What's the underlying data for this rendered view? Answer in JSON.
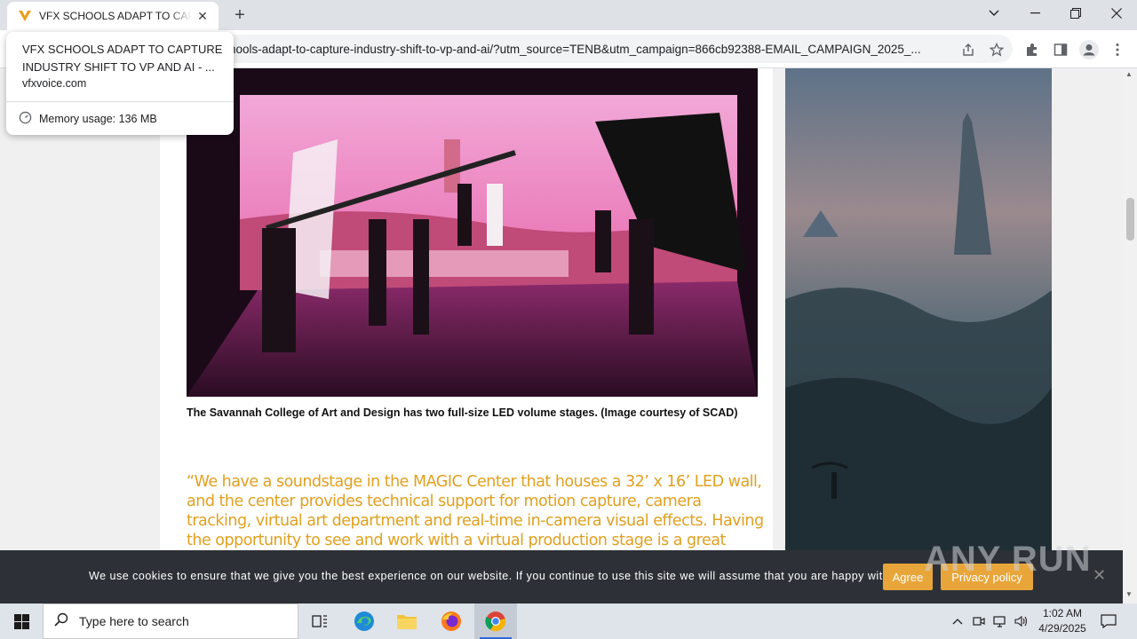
{
  "browser": {
    "tab_title": "VFX SCHOOLS ADAPT TO CAPTURE INDUSTRY SHIFT TO VP AND AI",
    "url": "hools-adapt-to-capture-industry-shift-to-vp-and-ai/?utm_source=TENB&utm_campaign=866cb92388-EMAIL_CAMPAIGN_2025_..."
  },
  "hovercard": {
    "title": "VFX SCHOOLS ADAPT TO CAPTURE INDUSTRY SHIFT TO VP AND AI - ...",
    "domain": "vfxvoice.com",
    "memory": "Memory usage: 136 MB"
  },
  "article": {
    "caption": "The Savannah College of Art and Design has two full-size LED volume stages. (Image courtesy of SCAD)",
    "quote": "“We have a soundstage in the MAGIC Center that houses a 32’ x 16’ LED wall, and the center provides technical support for motion capture, camera tracking, virtual art department and real-time in-camera visual effects. Having the opportunity to see and work with a virtual production stage is a great asset for our graduates.”"
  },
  "cookie": {
    "text": "We use cookies to ensure that we give you the best experience on our website. If you continue to use this site we will assume that you are happy with it.",
    "agree": "Agree",
    "privacy": "Privacy policy"
  },
  "watermark": "ANY RUN",
  "taskbar": {
    "search_placeholder": "Type here to search",
    "time": "1:02 AM",
    "date": "4/29/2025"
  },
  "colors": {
    "quote": "#e0a020",
    "cookie_button": "#e8a63a",
    "cookie_bar": "#2d3137"
  }
}
